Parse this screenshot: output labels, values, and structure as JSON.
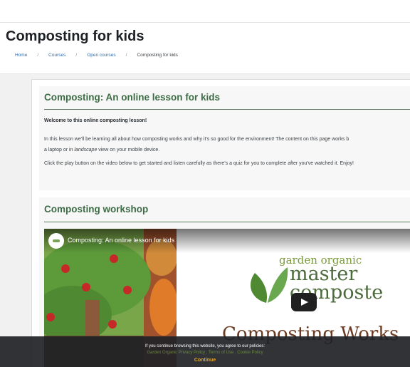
{
  "page": {
    "title": "Composting for kids"
  },
  "breadcrumb": {
    "items": [
      "Home",
      "Courses",
      "Open courses"
    ],
    "separator": "/",
    "current": "Composting for kids"
  },
  "lesson": {
    "heading": "Composting: An online lesson for kids",
    "intro": "Welcome to this online composting lesson!",
    "para1_line1": "In this lesson we'll be learning all about how composting works and why it's so good for the environment! The content on this page works b",
    "para1_line2_pre": "a laptop or in ",
    "para1_line2_em": "landscape",
    "para1_line2_post": " view on your mobile device.",
    "para2": "Click the play button on the video below to get started and listen carefully as there's a quiz for you to complete after you've watched it. Enjoy!"
  },
  "workshop": {
    "heading": "Composting workshop"
  },
  "video": {
    "title": "Composting: An online lesson for kids",
    "logo_line1": "garden organic",
    "logo_line2": "master",
    "logo_line3": "composte",
    "caption": "Composting Works"
  },
  "cookie": {
    "message": "If you continue browsing this website, you agree to our policies:",
    "links": [
      "Garden Organic Privacy Policy",
      "Terms of Use",
      "Cookie Policy"
    ],
    "link_separator": " , ",
    "continue_label": "Continue"
  },
  "colors": {
    "heading_green": "#3d6b45",
    "link_blue": "#2f6fb5",
    "cookie_accent": "#e5a524"
  }
}
